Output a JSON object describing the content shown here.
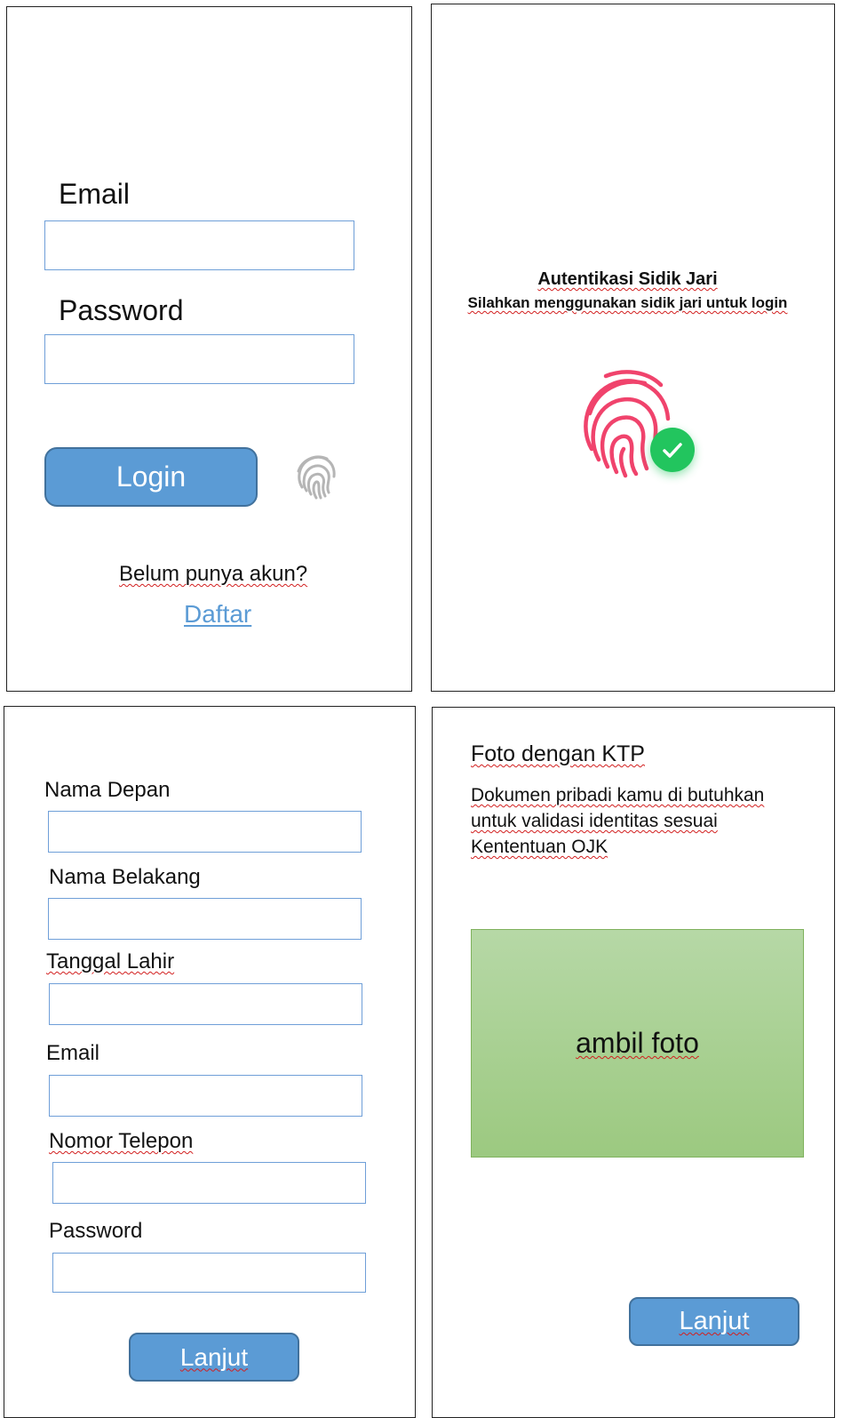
{
  "login_screen": {
    "email_label": "Email",
    "password_label": "Password",
    "login_button": "Login",
    "no_account_text": "Belum punya akun?",
    "register_link": "Daftar"
  },
  "fingerprint_screen": {
    "title": "Autentikasi Sidik Jari",
    "subtitle": "Silahkan menggunakan sidik jari untuk login",
    "icon": "fingerprint-icon",
    "status_icon": "check-circle-icon"
  },
  "register_screen": {
    "first_name_label": "Nama Depan",
    "last_name_label": "Nama Belakang",
    "birth_date_label": "Tanggal Lahir",
    "email_label": "Email",
    "phone_label": "Nomor Telepon",
    "password_label": "Password",
    "next_button": "Lanjut"
  },
  "ktp_screen": {
    "title": "Foto dengan KTP",
    "description_line1": "Dokumen pribadi kamu di butuhkan",
    "description_line2": "untuk validasi identitas sesuai",
    "description_line3": "Kententuan OJK",
    "photo_button": "ambil foto",
    "next_button": "Lanjut"
  },
  "colors": {
    "accent": "#5b9bd5",
    "accent_border": "#41719c",
    "fingerprint": "#f0436c",
    "check": "#22c55e",
    "photo_box_top": "#b6d8a6",
    "photo_box_bottom": "#9cc980"
  }
}
